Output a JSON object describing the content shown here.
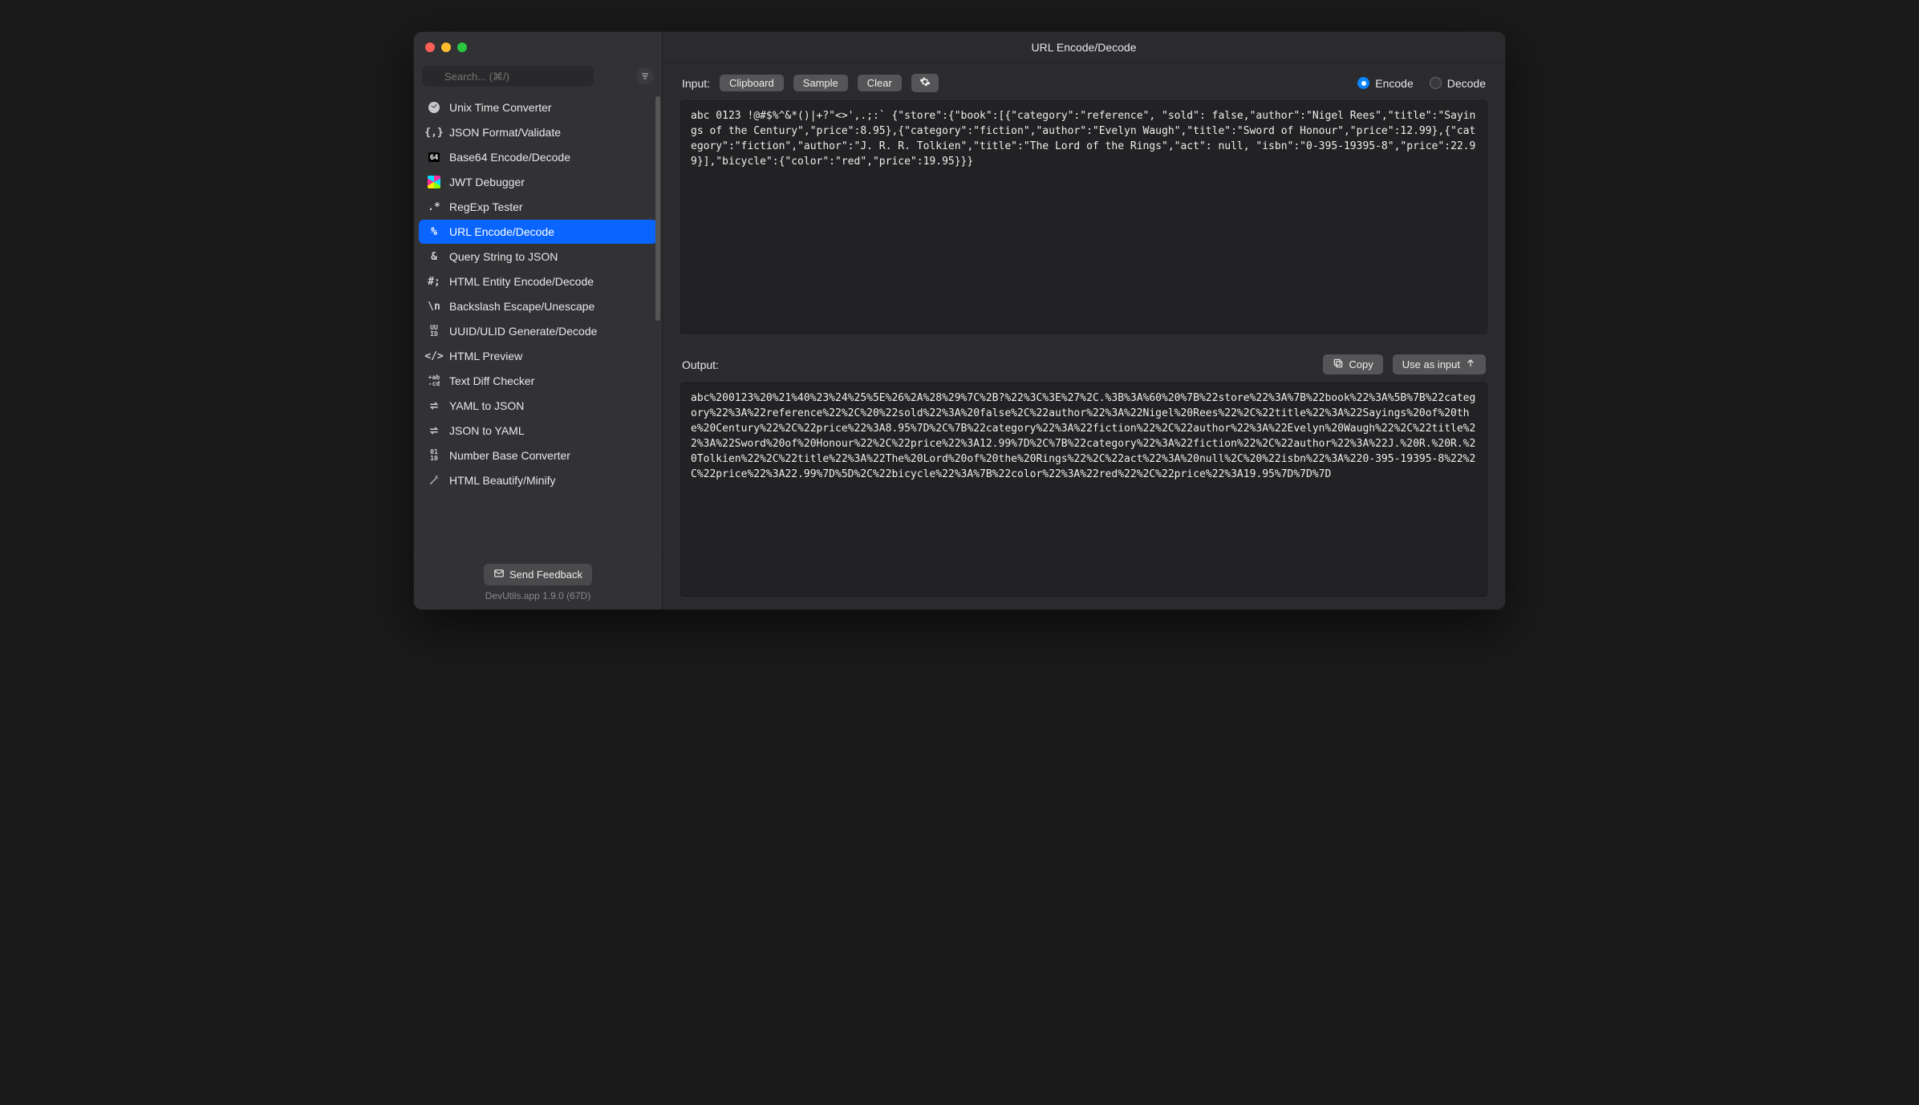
{
  "header": {
    "title": "URL Encode/Decode"
  },
  "search": {
    "placeholder": "Search... (⌘/)"
  },
  "sidebar": {
    "items": [
      {
        "label": "Unix Time Converter",
        "icon": "clock"
      },
      {
        "label": "JSON Format/Validate",
        "icon": "braces"
      },
      {
        "label": "Base64 Encode/Decode",
        "icon": "b64"
      },
      {
        "label": "JWT Debugger",
        "icon": "jwt"
      },
      {
        "label": "RegExp Tester",
        "icon": "regex"
      },
      {
        "label": "URL Encode/Decode",
        "icon": "percent",
        "selected": true
      },
      {
        "label": "Query String to JSON",
        "icon": "amp"
      },
      {
        "label": "HTML Entity Encode/Decode",
        "icon": "hash"
      },
      {
        "label": "Backslash Escape/Unescape",
        "icon": "bslash"
      },
      {
        "label": "UUID/ULID Generate/Decode",
        "icon": "uuid"
      },
      {
        "label": "HTML Preview",
        "icon": "code"
      },
      {
        "label": "Text Diff Checker",
        "icon": "diff"
      },
      {
        "label": "YAML to JSON",
        "icon": "swap"
      },
      {
        "label": "JSON to YAML",
        "icon": "swap"
      },
      {
        "label": "Number Base Converter",
        "icon": "binary"
      },
      {
        "label": "HTML Beautify/Minify",
        "icon": "wand"
      }
    ]
  },
  "footer": {
    "feedback": "Send Feedback",
    "version": "DevUtils.app 1.9.0 (67D)"
  },
  "toolbar": {
    "input_label": "Input:",
    "clipboard": "Clipboard",
    "sample": "Sample",
    "clear": "Clear",
    "encode": "Encode",
    "decode": "Decode",
    "mode": "encode"
  },
  "input_text": "abc 0123 !@#$%^&*()|+?\"<>',.;:` {\"store\":{\"book\":[{\"category\":\"reference\", \"sold\": false,\"author\":\"Nigel Rees\",\"title\":\"Sayings of the Century\",\"price\":8.95},{\"category\":\"fiction\",\"author\":\"Evelyn Waugh\",\"title\":\"Sword of Honour\",\"price\":12.99},{\"category\":\"fiction\",\"author\":\"J. R. R. Tolkien\",\"title\":\"The Lord of the Rings\",\"act\": null, \"isbn\":\"0-395-19395-8\",\"price\":22.99}],\"bicycle\":{\"color\":\"red\",\"price\":19.95}}}",
  "output": {
    "label": "Output:",
    "copy": "Copy",
    "use_as_input": "Use as input",
    "text": "abc%200123%20%21%40%23%24%25%5E%26%2A%28%29%7C%2B?%22%3C%3E%27%2C.%3B%3A%60%20%7B%22store%22%3A%7B%22book%22%3A%5B%7B%22category%22%3A%22reference%22%2C%20%22sold%22%3A%20false%2C%22author%22%3A%22Nigel%20Rees%22%2C%22title%22%3A%22Sayings%20of%20the%20Century%22%2C%22price%22%3A8.95%7D%2C%7B%22category%22%3A%22fiction%22%2C%22author%22%3A%22Evelyn%20Waugh%22%2C%22title%22%3A%22Sword%20of%20Honour%22%2C%22price%22%3A12.99%7D%2C%7B%22category%22%3A%22fiction%22%2C%22author%22%3A%22J.%20R.%20R.%20Tolkien%22%2C%22title%22%3A%22The%20Lord%20of%20the%20Rings%22%2C%22act%22%3A%20null%2C%20%22isbn%22%3A%220-395-19395-8%22%2C%22price%22%3A22.99%7D%5D%2C%22bicycle%22%3A%7B%22color%22%3A%22red%22%2C%22price%22%3A19.95%7D%7D%7D"
  }
}
